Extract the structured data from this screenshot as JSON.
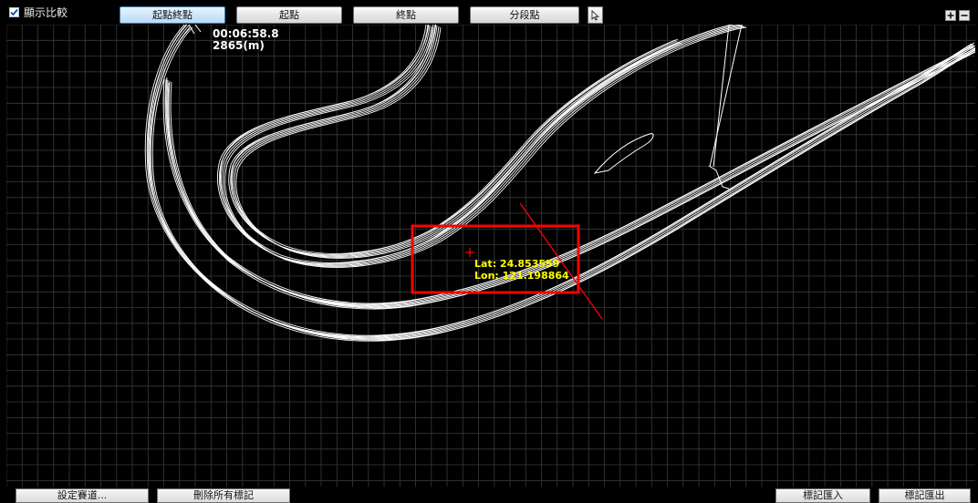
{
  "toolbar": {
    "compare_label": "顯示比較",
    "compare_checked": true,
    "buttons": [
      "起點終點",
      "起點",
      "終點",
      "分段點"
    ],
    "active_button": "起點終點",
    "cursor_icon": "pointer-arrow-icon",
    "zoom_in_icon": "plus-icon",
    "zoom_out_icon": "minus-icon"
  },
  "map": {
    "lap_time": "00:06:58.8",
    "distance": "2865(m)",
    "cursor_marker_icon": "crosshair-plus-icon",
    "lat_text": "Lat: 24.853559",
    "lon_text": "Lon: 121.198864",
    "selection_color": "#ff0000",
    "track_color": "#ffffff",
    "grid_color": "#3a3a3a",
    "coord_color": "#ffff00",
    "background_color": "#000000"
  },
  "bottom": {
    "set_track": "設定賽道...",
    "delete_marks": "刪除所有標記",
    "import_marks": "標記匯入",
    "export_marks": "標記匯出"
  }
}
